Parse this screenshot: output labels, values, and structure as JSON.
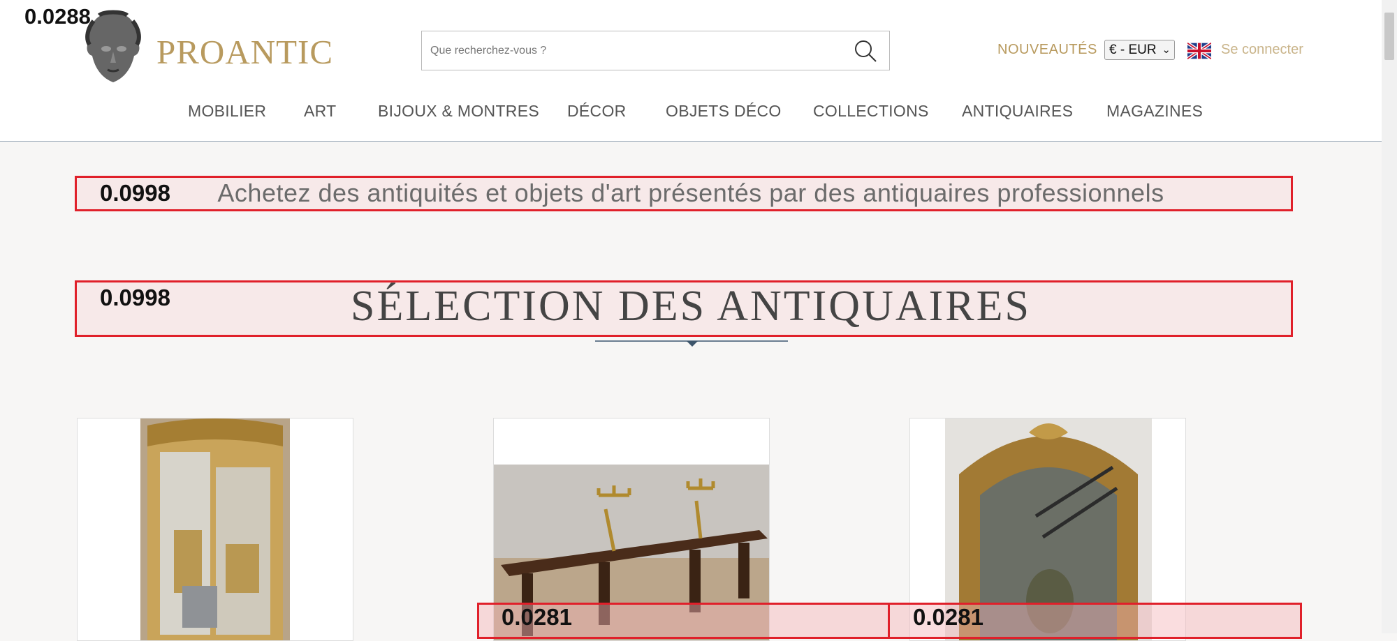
{
  "brand": {
    "name": "PROANTIC"
  },
  "search": {
    "placeholder": "Que recherchez-vous ?"
  },
  "header_right": {
    "new_label": "NOUVEAUTÉS",
    "currency": "€ - EUR",
    "login_label": "Se connecter"
  },
  "nav": {
    "items": [
      "MOBILIER",
      "ART",
      "BIJOUX & MONTRES",
      "DÉCOR",
      "OBJETS DÉCO",
      "COLLECTIONS",
      "ANTIQUAIRES",
      "MAGAZINES"
    ]
  },
  "hero": {
    "tagline": "Achetez des antiquités et objets d'art présentés par des antiquaires professionnels",
    "section_title": "SÉLECTION DES ANTIQUAIRES"
  },
  "overlay_scores": {
    "logo": "0.0288",
    "tagline": "0.0998",
    "title": "0.0998",
    "card2": "0.0281",
    "card3": "0.0281"
  },
  "colors": {
    "brand_gold": "#b89a5e",
    "overlay_red": "#e0202a"
  }
}
